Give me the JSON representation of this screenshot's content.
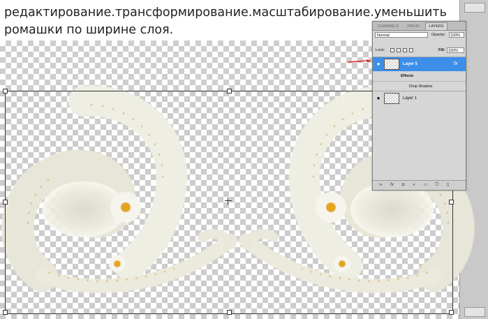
{
  "caption": "редактирование.трансформирование.масштабирование.уменьшить ромашки по ширине слоя.",
  "panel": {
    "tabs": [
      "CHANNELS",
      "PATHS",
      "LAYERS"
    ],
    "blend_mode": "Normal",
    "opacity_label": "Opacity:",
    "opacity_value": "100%",
    "lock_label": "Lock:",
    "fill_label": "Fill:",
    "fill_value": "100%",
    "layers": [
      {
        "name": "Layer 5",
        "selected": true,
        "fx": "fx"
      },
      {
        "name": "Layer 1",
        "selected": false
      }
    ],
    "effects_label": "Effects",
    "effect_item": "Drop Shadow",
    "bottom_icons": [
      "link-icon",
      "fx-icon",
      "mask-icon",
      "adjustment-icon",
      "folder-icon",
      "new-layer-icon",
      "trash-icon"
    ]
  },
  "colors": {
    "selection": "#3d8ee8",
    "arrow": "#d8262a",
    "flower_petal": "#eeeedf",
    "flower_center": "#e2a51b"
  }
}
